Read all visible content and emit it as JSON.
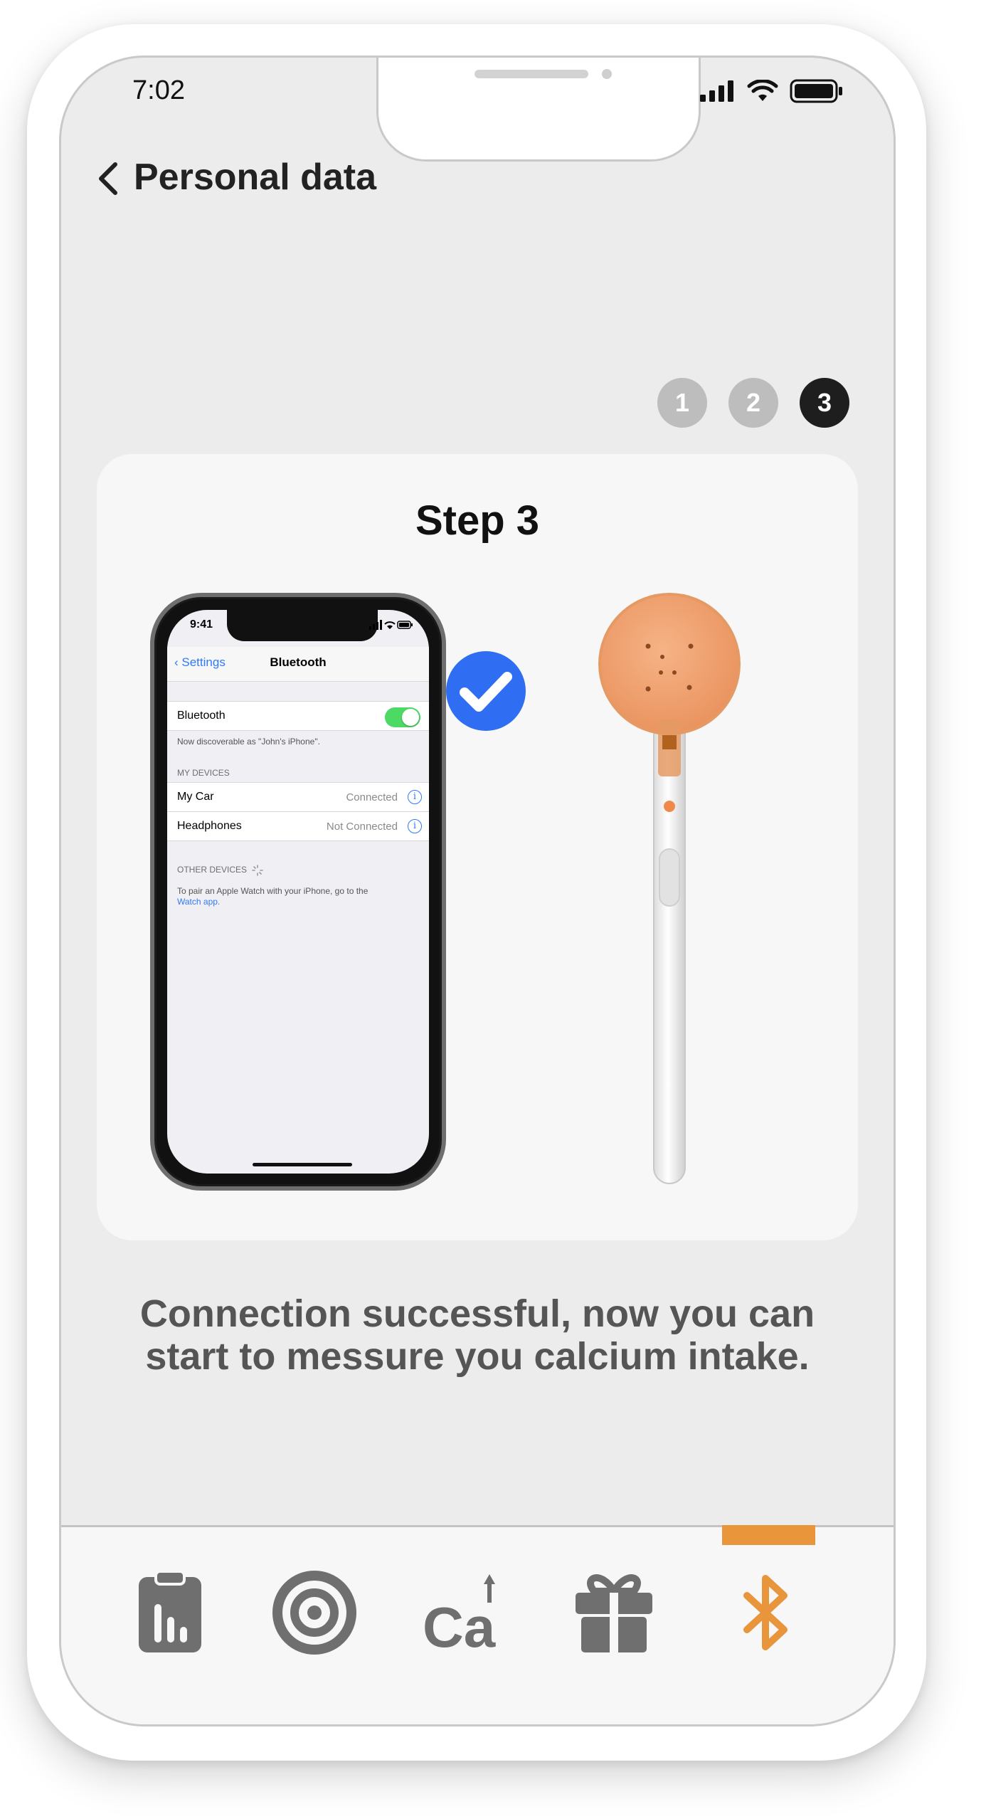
{
  "status_bar": {
    "time": "7:02"
  },
  "nav": {
    "title": "Personal data"
  },
  "steps": [
    "1",
    "2",
    "3"
  ],
  "active_step": "3",
  "card": {
    "title": "Step 3"
  },
  "illustration": {
    "time": "9:41",
    "back_label": "Settings",
    "title": "Bluetooth",
    "bluetooth_label": "Bluetooth",
    "discoverable_note": "Now discoverable as \"John's iPhone\".",
    "my_devices_header": "MY DEVICES",
    "devices": [
      {
        "name": "My Car",
        "status": "Connected"
      },
      {
        "name": "Headphones",
        "status": "Not Connected"
      }
    ],
    "other_devices_header": "OTHER DEVICES",
    "pair_note": "To pair an Apple Watch with your iPhone, go to the",
    "pair_link": "Watch app."
  },
  "message": {
    "line1": "Connection successful, now you can",
    "line2": "start to messure you calcium intake."
  },
  "tabbar": {
    "items": [
      "clipboard-chart",
      "target",
      "calcium",
      "gift",
      "bluetooth"
    ],
    "active": "bluetooth",
    "calcium_label": "Ca"
  },
  "colors": {
    "accent": "#e8953c",
    "check_blue": "#2f6ef2",
    "icon_gray": "#6f6f6f",
    "step_inactive": "#bdbdbd",
    "step_active": "#1e1e1e"
  }
}
